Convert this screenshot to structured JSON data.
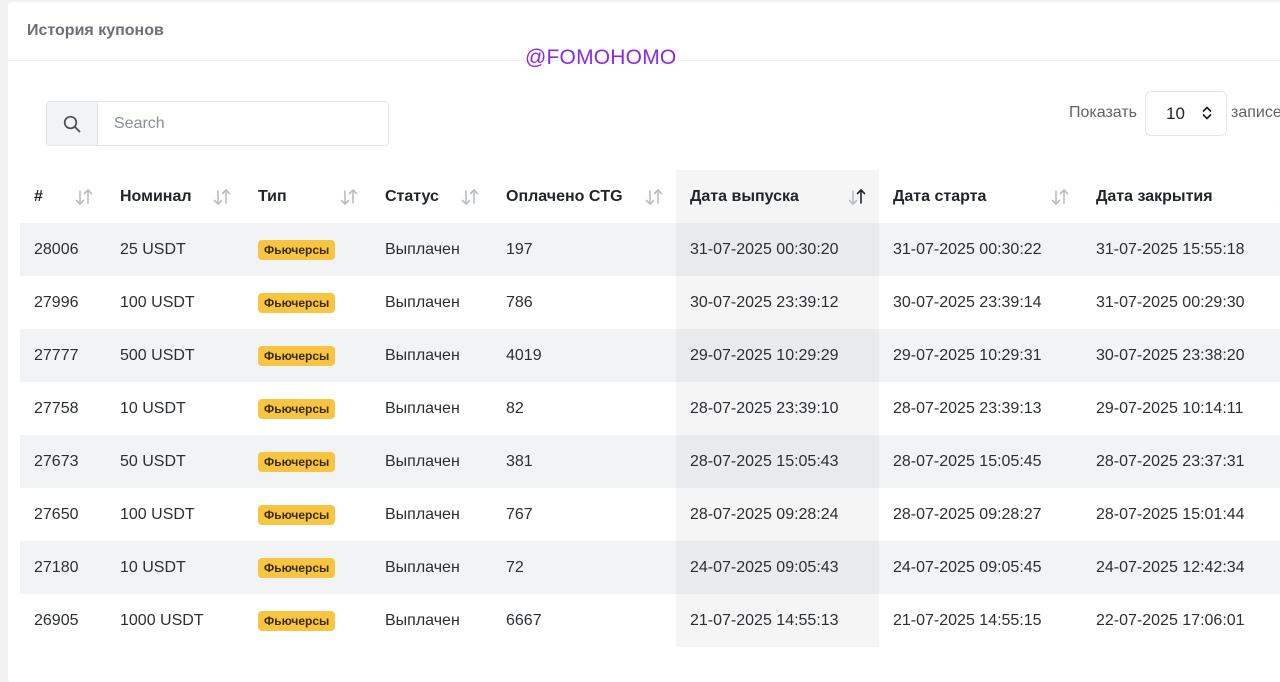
{
  "header": {
    "title": "История купонов"
  },
  "watermark": "@FOMOHOMO",
  "search": {
    "placeholder": "Search",
    "value": ""
  },
  "length_menu": {
    "show_label": "Показать",
    "selected": "10",
    "records_label": "записей"
  },
  "colors": {
    "badge": "#f7c542",
    "watermark": "#8a2be2"
  },
  "table": {
    "columns": [
      {
        "label": "#",
        "sort": "none"
      },
      {
        "label": "Номинал",
        "sort": "none"
      },
      {
        "label": "Тип",
        "sort": "none"
      },
      {
        "label": "Статус",
        "sort": "none"
      },
      {
        "label": "Оплачено CTG",
        "sort": "none"
      },
      {
        "label": "Дата выпуска",
        "sort": "desc"
      },
      {
        "label": "Дата старта",
        "sort": "none"
      },
      {
        "label": "Дата закрытия",
        "sort": "none"
      }
    ],
    "rows": [
      {
        "id": "28006",
        "nominal": "25 USDT",
        "type": "Фьючерсы",
        "status": "Выплачен",
        "paid": "197",
        "issued": "31-07-2025 00:30:20",
        "started": "31-07-2025 00:30:22",
        "closed": "31-07-2025 15:55:18"
      },
      {
        "id": "27996",
        "nominal": "100 USDT",
        "type": "Фьючерсы",
        "status": "Выплачен",
        "paid": "786",
        "issued": "30-07-2025 23:39:12",
        "started": "30-07-2025 23:39:14",
        "closed": "31-07-2025 00:29:30"
      },
      {
        "id": "27777",
        "nominal": "500 USDT",
        "type": "Фьючерсы",
        "status": "Выплачен",
        "paid": "4019",
        "issued": "29-07-2025 10:29:29",
        "started": "29-07-2025 10:29:31",
        "closed": "30-07-2025 23:38:20"
      },
      {
        "id": "27758",
        "nominal": "10 USDT",
        "type": "Фьючерсы",
        "status": "Выплачен",
        "paid": "82",
        "issued": "28-07-2025 23:39:10",
        "started": "28-07-2025 23:39:13",
        "closed": "29-07-2025 10:14:11"
      },
      {
        "id": "27673",
        "nominal": "50 USDT",
        "type": "Фьючерсы",
        "status": "Выплачен",
        "paid": "381",
        "issued": "28-07-2025 15:05:43",
        "started": "28-07-2025 15:05:45",
        "closed": "28-07-2025 23:37:31"
      },
      {
        "id": "27650",
        "nominal": "100 USDT",
        "type": "Фьючерсы",
        "status": "Выплачен",
        "paid": "767",
        "issued": "28-07-2025 09:28:24",
        "started": "28-07-2025 09:28:27",
        "closed": "28-07-2025 15:01:44"
      },
      {
        "id": "27180",
        "nominal": "10 USDT",
        "type": "Фьючерсы",
        "status": "Выплачен",
        "paid": "72",
        "issued": "24-07-2025 09:05:43",
        "started": "24-07-2025 09:05:45",
        "closed": "24-07-2025 12:42:34"
      },
      {
        "id": "26905",
        "nominal": "1000 USDT",
        "type": "Фьючерсы",
        "status": "Выплачен",
        "paid": "6667",
        "issued": "21-07-2025 14:55:13",
        "started": "21-07-2025 14:55:15",
        "closed": "22-07-2025 17:06:01"
      }
    ]
  }
}
